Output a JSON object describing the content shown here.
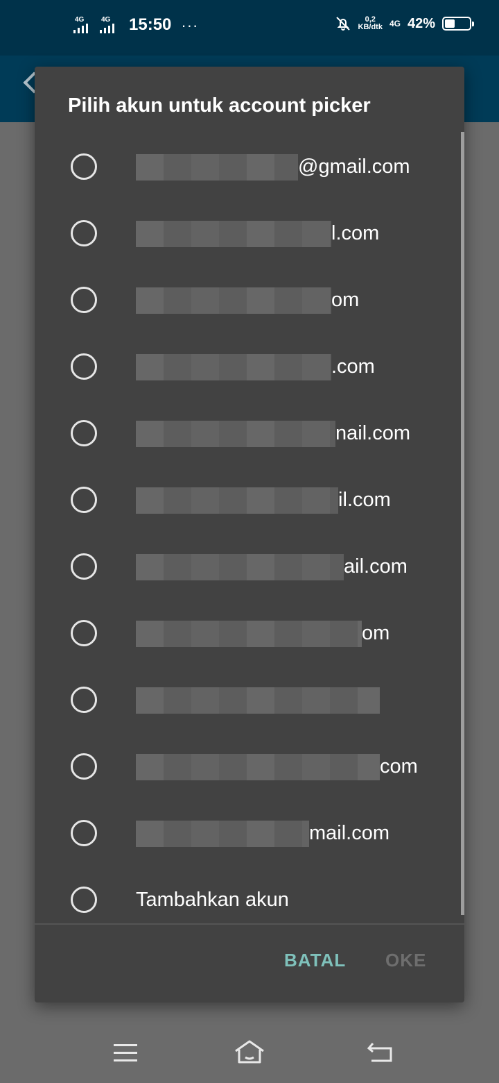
{
  "status_bar": {
    "sim1_label": "4G",
    "sim2_label": "4G",
    "time": "15:50",
    "more_indicator": "···",
    "speed_value": "0,2",
    "speed_unit": "KB/dtk",
    "network_label": "4G",
    "battery_percent": "42%",
    "battery_level": 0.42
  },
  "dialog": {
    "title": "Pilih akun untuk account picker",
    "accounts": [
      {
        "visible_suffix": "@gmail.com",
        "selected": false
      },
      {
        "visible_suffix": "l.com",
        "selected": false
      },
      {
        "visible_suffix": "om",
        "selected": false
      },
      {
        "visible_suffix": ".com",
        "selected": false
      },
      {
        "visible_suffix": "nail.com",
        "selected": false
      },
      {
        "visible_suffix": "il.com",
        "selected": false
      },
      {
        "visible_suffix": "ail.com",
        "selected": false
      },
      {
        "visible_suffix": "om",
        "selected": false
      },
      {
        "visible_suffix": "",
        "selected": false
      },
      {
        "visible_suffix": "com",
        "selected": false
      },
      {
        "visible_suffix": "mail.com",
        "selected": false
      }
    ],
    "add_account_label": "Tambahkan akun",
    "cancel_label": "BATAL",
    "ok_label": "OKE"
  },
  "colors": {
    "status_bar": "#00324a",
    "app_bar": "#003b57",
    "dialog_bg": "#424242",
    "accent": "#7fc1bb",
    "disabled": "#6e6e6e"
  },
  "icons": {
    "nav_menu": "menu-icon",
    "nav_home": "home-icon",
    "nav_back": "back-icon",
    "notifications_off": "bell-off-icon"
  }
}
